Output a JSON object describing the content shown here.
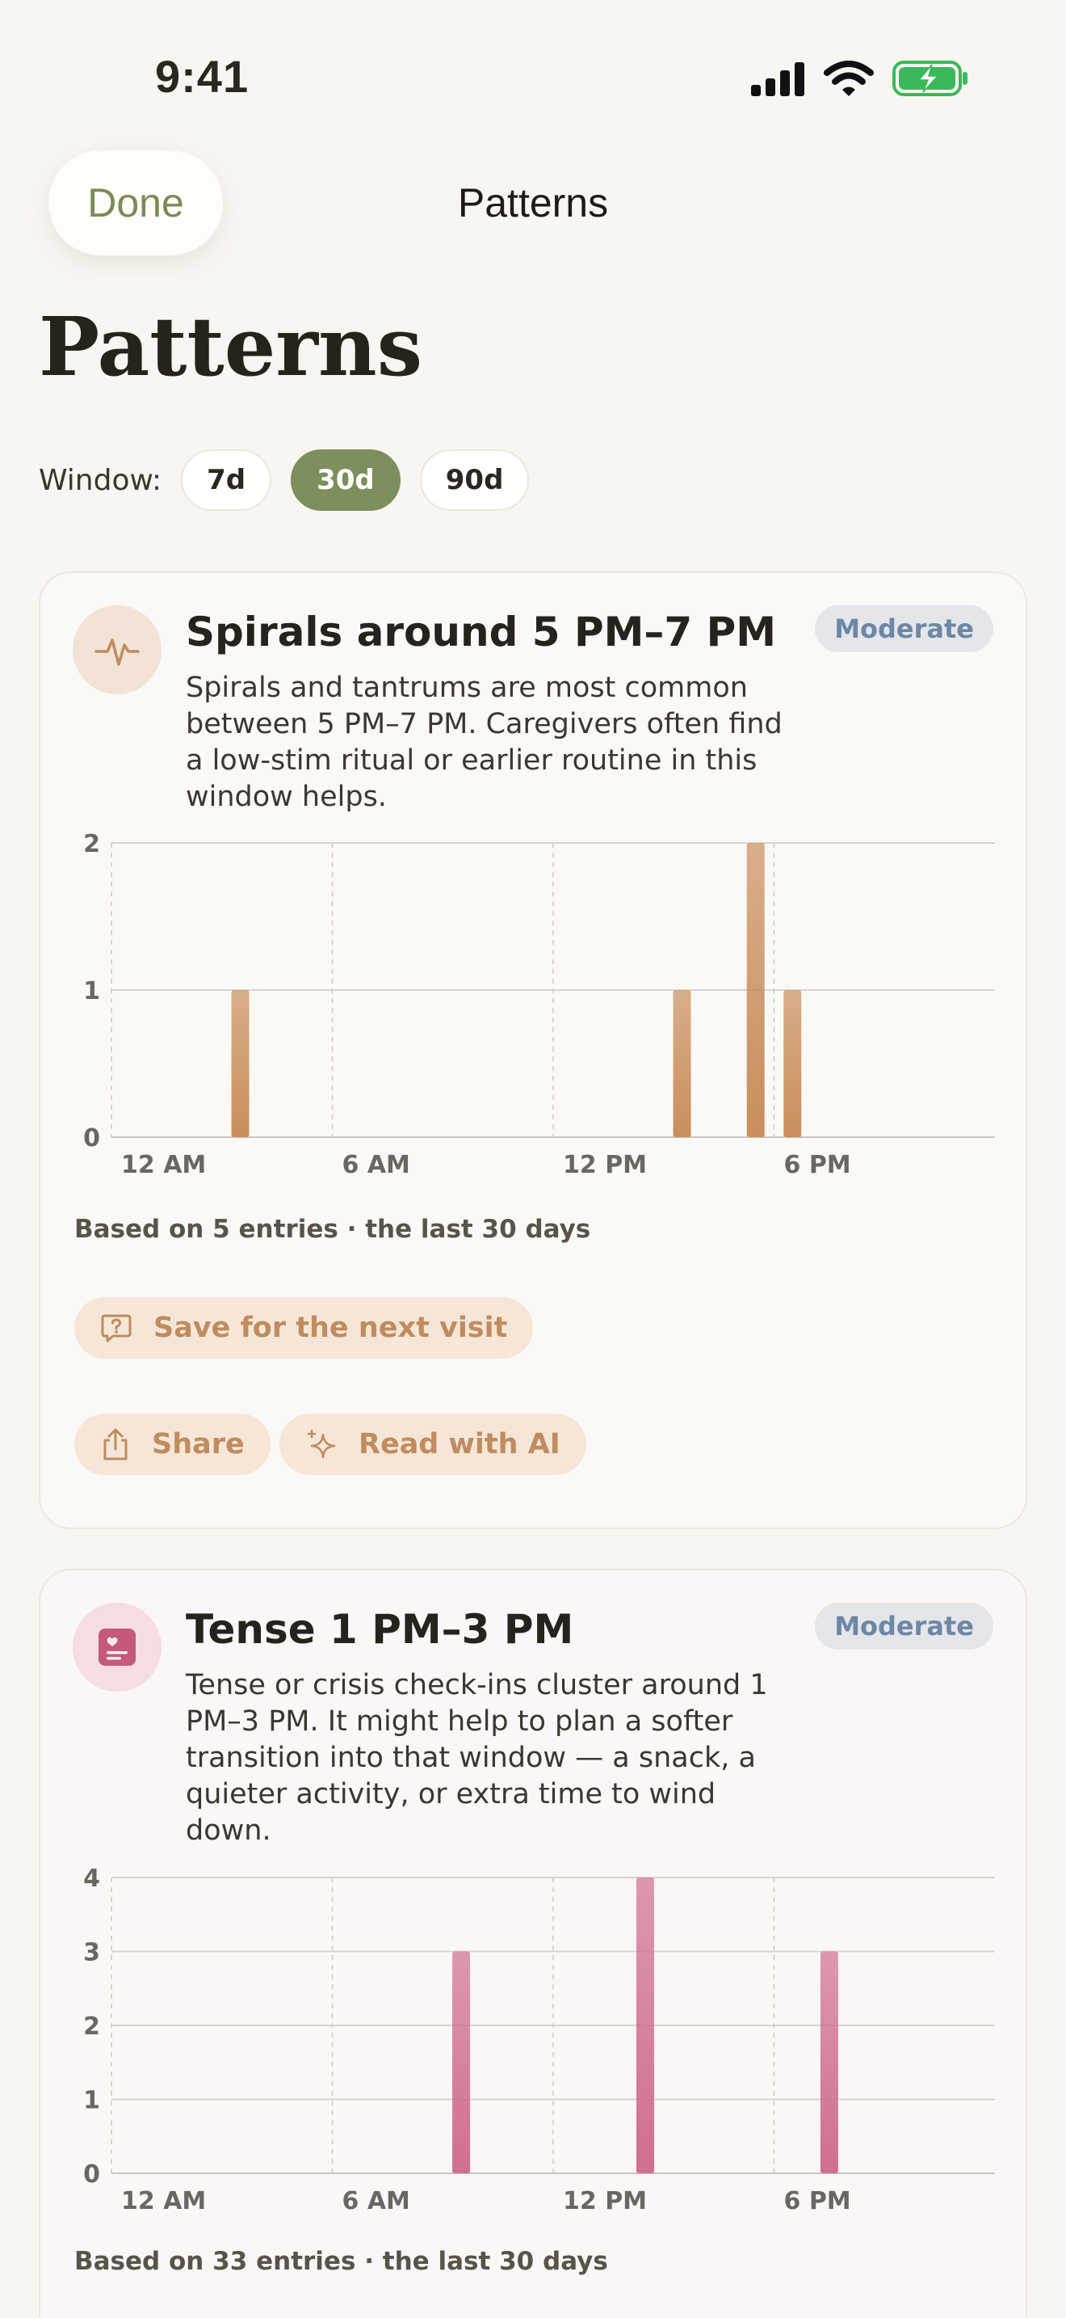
{
  "status_bar": {
    "time": "9:41"
  },
  "nav": {
    "done_label": "Done",
    "title": "Patterns"
  },
  "page_title": "Patterns",
  "window": {
    "label": "Window:",
    "options": [
      "7d",
      "30d",
      "90d"
    ],
    "selected": "30d"
  },
  "colors": {
    "accent": "#7c8f5c",
    "bar_orange": "#c98e5c",
    "bar_pink": "#cf6f8f",
    "badge_text": "#6e87a6",
    "pill_text": "#c08c5e"
  },
  "cards": [
    {
      "icon": "pulse-icon",
      "title": "Spirals around 5 PM–7 PM",
      "badge": "Moderate",
      "description": "Spirals and tantrums are most common between 5 PM–7 PM. Caregivers often find a low-stim ritual or earlier routine in this window helps.",
      "based_on": "Based on 5 entries · the last 30 days",
      "actions": {
        "save": "Save for the next visit",
        "share": "Share",
        "read_ai": "Read with AI"
      }
    },
    {
      "icon": "journal-heart-icon",
      "title": "Tense 1 PM–3 PM",
      "badge": "Moderate",
      "description": "Tense or crisis check-ins cluster around 1 PM–3 PM. It might help to plan a softer transition into that window — a snack, a quieter activity, or extra time to wind down.",
      "based_on": "Based on 33 entries · the last 30 days"
    }
  ],
  "chart_data": [
    {
      "type": "bar",
      "x_unit": "hour of day",
      "xlim": [
        0,
        23
      ],
      "x_tick_labels": [
        "12 AM",
        "6 AM",
        "12 PM",
        "6 PM"
      ],
      "x_tick_values": [
        0,
        6,
        12,
        18
      ],
      "ylim": [
        0,
        2
      ],
      "y_ticks": [
        0,
        1,
        2
      ],
      "grid": true,
      "points": [
        {
          "x": 3,
          "y": 1
        },
        {
          "x": 15,
          "y": 1
        },
        {
          "x": 17,
          "y": 2
        },
        {
          "x": 18,
          "y": 1
        }
      ]
    },
    {
      "type": "bar",
      "x_unit": "hour of day",
      "xlim": [
        0,
        23
      ],
      "x_tick_labels": [
        "12 AM",
        "6 AM",
        "12 PM",
        "6 PM"
      ],
      "x_tick_values": [
        0,
        6,
        12,
        18
      ],
      "ylim": [
        0,
        4
      ],
      "y_ticks": [
        0,
        1,
        2,
        3,
        4
      ],
      "grid": true,
      "points": [
        {
          "x": 9,
          "y": 3
        },
        {
          "x": 14,
          "y": 4
        },
        {
          "x": 19,
          "y": 3
        }
      ]
    }
  ]
}
